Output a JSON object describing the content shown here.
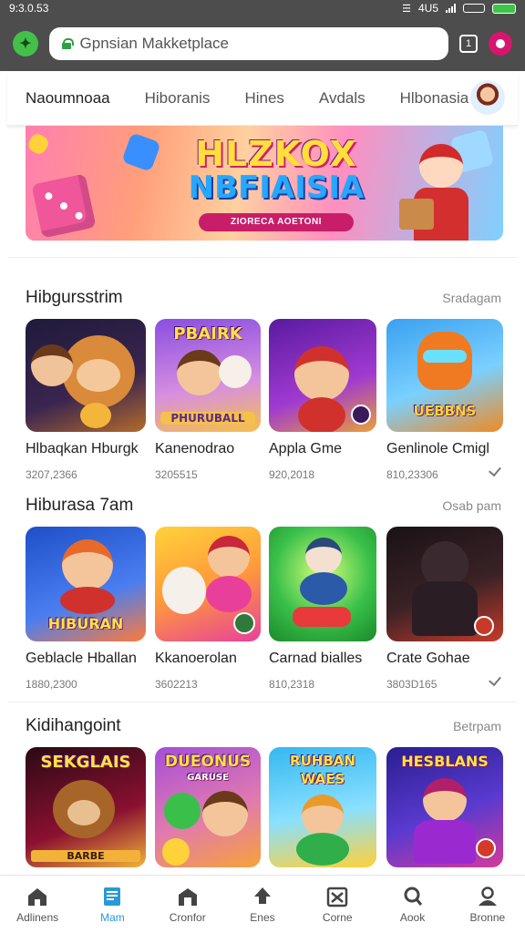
{
  "status_bar": {
    "time": "9:3.0.53",
    "icons_text": "4U5"
  },
  "browser": {
    "url_value": "Gpnsian Makketplace",
    "tabs_count": "1"
  },
  "category_nav": {
    "tabs": [
      {
        "label": "Naoumnoaa",
        "active": true
      },
      {
        "label": "Hiboranis",
        "active": false
      },
      {
        "label": "Hines",
        "active": false
      },
      {
        "label": "Avdals",
        "active": false
      },
      {
        "label": "Hlbonasia",
        "active": false
      }
    ]
  },
  "banner": {
    "title_line1": "HLZKOX",
    "title_line2": "NBFIAISIA",
    "subtitle": "ZIORECA AOETONI"
  },
  "sections": [
    {
      "title": "Hibgursstrim",
      "more": "Sradagam",
      "cards": [
        {
          "name": "Hlbaqkan Hburgk",
          "meta": "3207,2366",
          "thumb_text": "",
          "checked": false,
          "palette": [
            "#2b1a40",
            "#e08a3a"
          ]
        },
        {
          "name": "Kanenodrao",
          "meta": "3205515",
          "thumb_text_top": "PBAIRK",
          "thumb_text_bottom": "PHURUBALL",
          "checked": false,
          "palette": [
            "#9b5de5",
            "#f4c14b"
          ]
        },
        {
          "name": "Appla Gme",
          "meta": "920,2018",
          "thumb_text": "",
          "checked": false,
          "palette": [
            "#6a1fa0",
            "#d8292c"
          ]
        },
        {
          "name": "Genlinole Cmigl",
          "meta": "810,23306",
          "thumb_text_bottom": "UEBBNS",
          "checked": true,
          "palette": [
            "#2c8fe0",
            "#f07a22"
          ]
        }
      ]
    },
    {
      "title": "Hiburasa 7am",
      "more": "Osab pam",
      "cards": [
        {
          "name": "Geblacle Hballan",
          "meta": "1880,2300",
          "thumb_text_bottom": "HIBURAN",
          "checked": false,
          "palette": [
            "#2563d8",
            "#ff6b3d"
          ]
        },
        {
          "name": "Kkanoerolan",
          "meta": "3602213",
          "thumb_text": "",
          "checked": false,
          "palette": [
            "#ffcf3d",
            "#e8409a"
          ]
        },
        {
          "name": "Carnad bialles",
          "meta": "810,2318",
          "thumb_text": "",
          "checked": false,
          "palette": [
            "#27b34a",
            "#b8ef5d"
          ]
        },
        {
          "name": "Crate Gohae",
          "meta": "3803D165",
          "thumb_text": "",
          "checked": true,
          "palette": [
            "#2a1a22",
            "#c73a2a"
          ]
        }
      ]
    },
    {
      "title": "Kidihangoint",
      "more": "Betrpam",
      "cards": [
        {
          "name": "",
          "meta": "",
          "thumb_text_top": "SEKGLAIS",
          "thumb_text_bottom": "BARBE",
          "checked": false,
          "palette": [
            "#c2173a",
            "#f2b23a"
          ]
        },
        {
          "name": "",
          "meta": "",
          "thumb_text_top": "DUEONUS",
          "thumb_text_bottom": "GARUSE",
          "checked": false,
          "palette": [
            "#a64dd8",
            "#f6a23a"
          ]
        },
        {
          "name": "",
          "meta": "",
          "thumb_text_top": "RUHBAN",
          "thumb_text_bottom": "WAES",
          "checked": false,
          "palette": [
            "#35b8f0",
            "#ffd13a"
          ]
        },
        {
          "name": "",
          "meta": "",
          "thumb_text_top": "HESBLANS",
          "thumb_text_bottom": "",
          "checked": false,
          "palette": [
            "#3a2aa8",
            "#d43a9a"
          ]
        }
      ]
    }
  ],
  "bottom_nav": [
    {
      "label": "Adlinens",
      "icon": "home-icon",
      "active": false
    },
    {
      "label": "Mam",
      "icon": "document-icon",
      "active": true
    },
    {
      "label": "Cronfor",
      "icon": "store-icon",
      "active": false
    },
    {
      "label": "Enes",
      "icon": "upload-icon",
      "active": false
    },
    {
      "label": "Corne",
      "icon": "box-icon",
      "active": false
    },
    {
      "label": "Aook",
      "icon": "search-icon",
      "active": false
    },
    {
      "label": "Bronne",
      "icon": "profile-icon",
      "active": false
    }
  ],
  "colors": {
    "accent": "#2a9ad6",
    "chrome": "#4d4d4d",
    "brand_green": "#44c04a"
  }
}
